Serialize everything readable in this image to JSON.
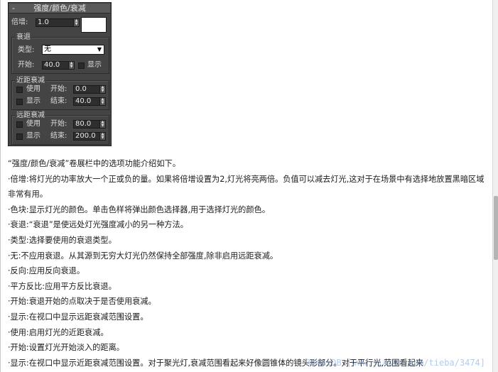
{
  "panel": {
    "title": "强度/颜色/衰减",
    "collapse_symbol": "-",
    "multiplier": {
      "label": "倍增:",
      "value": "1.0"
    },
    "color_swatch": "#ffffff",
    "decay": {
      "group_title": "衰退",
      "type_label": "类型:",
      "type_value": "无",
      "start_label": "开始:",
      "start_value": "40.0",
      "show_label": "显示"
    },
    "near": {
      "group_title": "近距衰减",
      "use_label": "使用",
      "show_label": "显示",
      "start_label": "开始:",
      "start_value": "0.0",
      "end_label": "结束:",
      "end_value": "40.0"
    },
    "far": {
      "group_title": "远距衰减",
      "use_label": "使用",
      "show_label": "显示",
      "start_label": "开始:",
      "start_value": "80.0",
      "end_label": "结束:",
      "end_value": "200.0"
    }
  },
  "body": {
    "lines": [
      "“强度/颜色/衰减”卷展栏中的选项功能介绍如下。",
      "·倍增:将灯光的功率放大一个正或负的量。如果将倍增设置为2,灯光将亮两倍。负值可以减去灯光,这对于在场景中有选择地放置黑暗区域非常有用。",
      "·色块:显示灯光的颜色。单击色样将弹出颜色选择器,用于选择灯光的颜色。",
      "·衰退:“衰退”是使远处灯光强度减小的另一种方法。",
      "·类型:选择要使用的衰退类型。",
      "·无:不应用衰退。从其源到无穷大灯光仍然保持全部强度,除非启用远距衰减。",
      "·反向:应用反向衰退。",
      "·平方反比:应用平方反比衰退。",
      "·开始:衰退开始的点取决于是否使用衰减。",
      "·显示:在视口中显示远距衰减范围设置。",
      "·使用:启用灯光的近距衰减。",
      "·开始:设置灯光开始淡入的距离。",
      "·显示:在视口中显示近距衰减范围设置。对于聚光灯,衰减范围看起来好像圆锥体的镜头形部分。对于平行光,范围看起来"
    ]
  },
  "watermark": "3DmaxDB [www.jiasee.com/tieba/3474]"
}
